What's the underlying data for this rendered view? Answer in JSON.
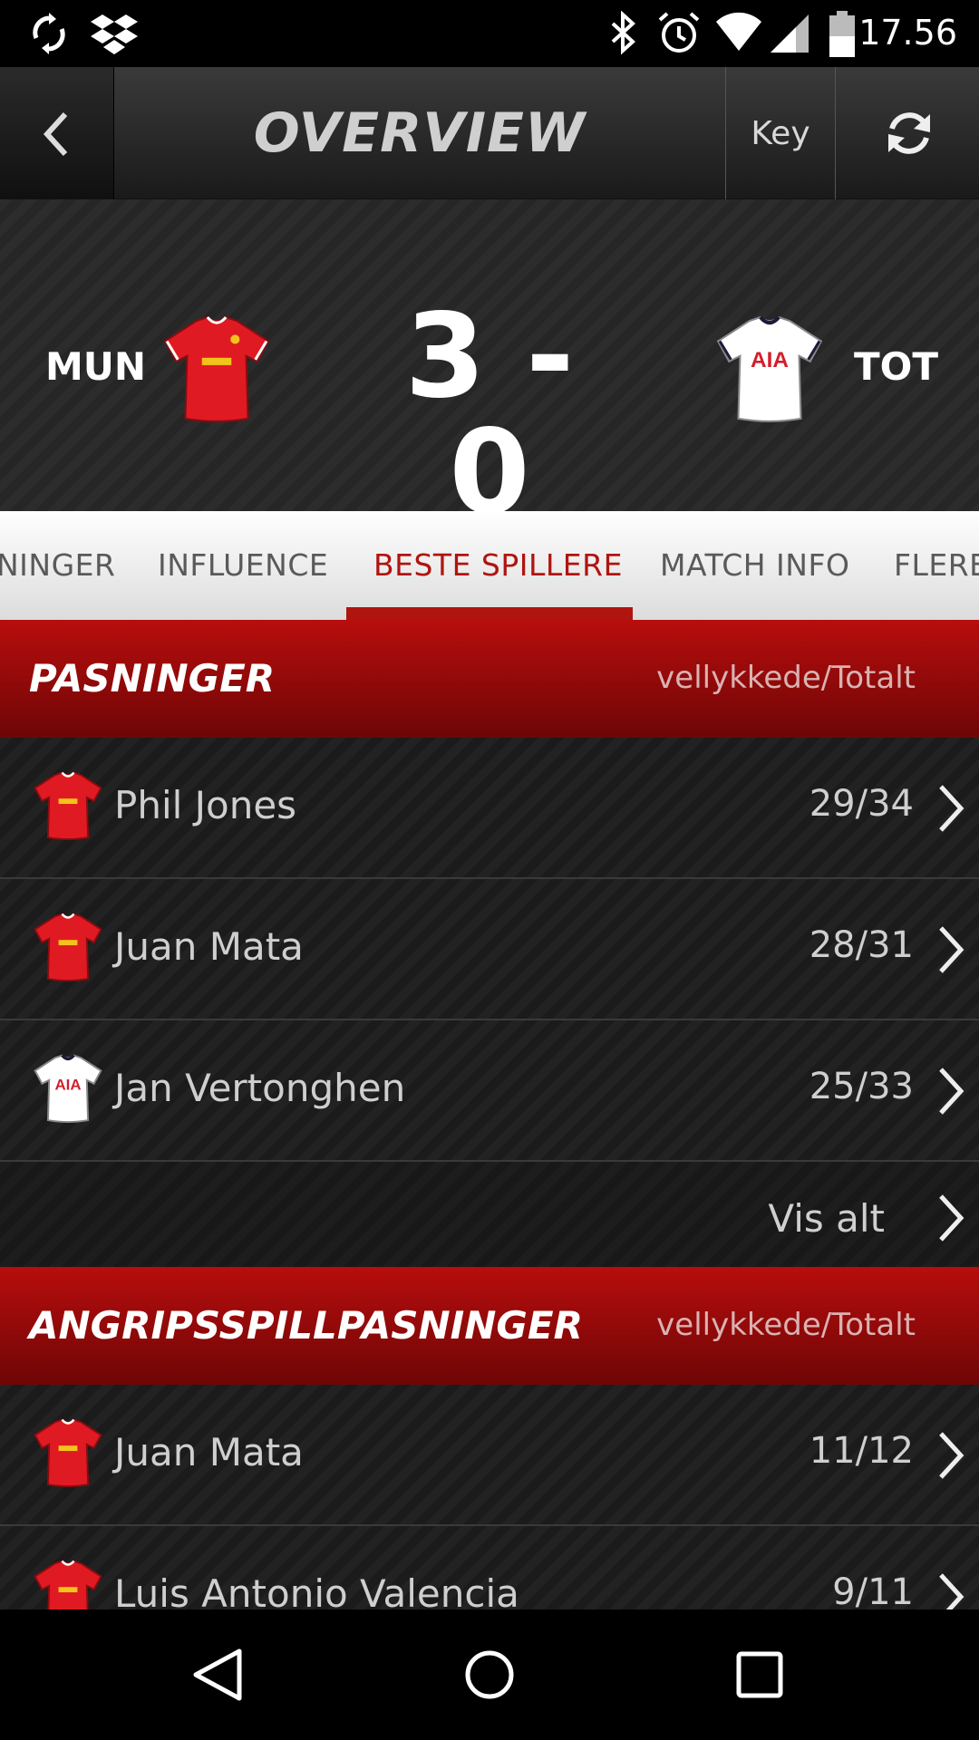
{
  "status_bar": {
    "time": "17.56",
    "icons": [
      "sync-icon",
      "dropbox-icon",
      "bluetooth-icon",
      "alarm-icon",
      "wifi-icon",
      "signal-icon",
      "battery-icon"
    ]
  },
  "app_bar": {
    "title": "OVERVIEW",
    "key_label": "Key"
  },
  "match": {
    "home_code": "MUN",
    "away_code": "TOT",
    "score": "3 - 0",
    "home_color": "#e01a22",
    "away_color": "#ffffff",
    "away_sponsor": "AIA"
  },
  "tabs": [
    "NINGER",
    "INFLUENCE",
    "BESTE SPILLERE",
    "MATCH INFO",
    "FLERE"
  ],
  "active_tab": "BESTE SPILLERE",
  "accent_color": "#b0140f",
  "sections": [
    {
      "title": "PASNINGER",
      "subtitle": "vellykkede/Totalt",
      "rows": [
        {
          "team": "MUN",
          "name": "Phil Jones",
          "value": "29/34"
        },
        {
          "team": "MUN",
          "name": "Juan Mata",
          "value": "28/31"
        },
        {
          "team": "TOT",
          "name": "Jan Vertonghen",
          "value": "25/33"
        }
      ],
      "more_label": "Vis alt"
    },
    {
      "title": "ANGRIPSSPILLPASNINGER",
      "subtitle": "vellykkede/Totalt",
      "rows": [
        {
          "team": "MUN",
          "name": "Juan Mata",
          "value": "11/12"
        },
        {
          "team": "MUN",
          "name": "Luis Antonio Valencia",
          "value": "9/11"
        }
      ]
    }
  ]
}
